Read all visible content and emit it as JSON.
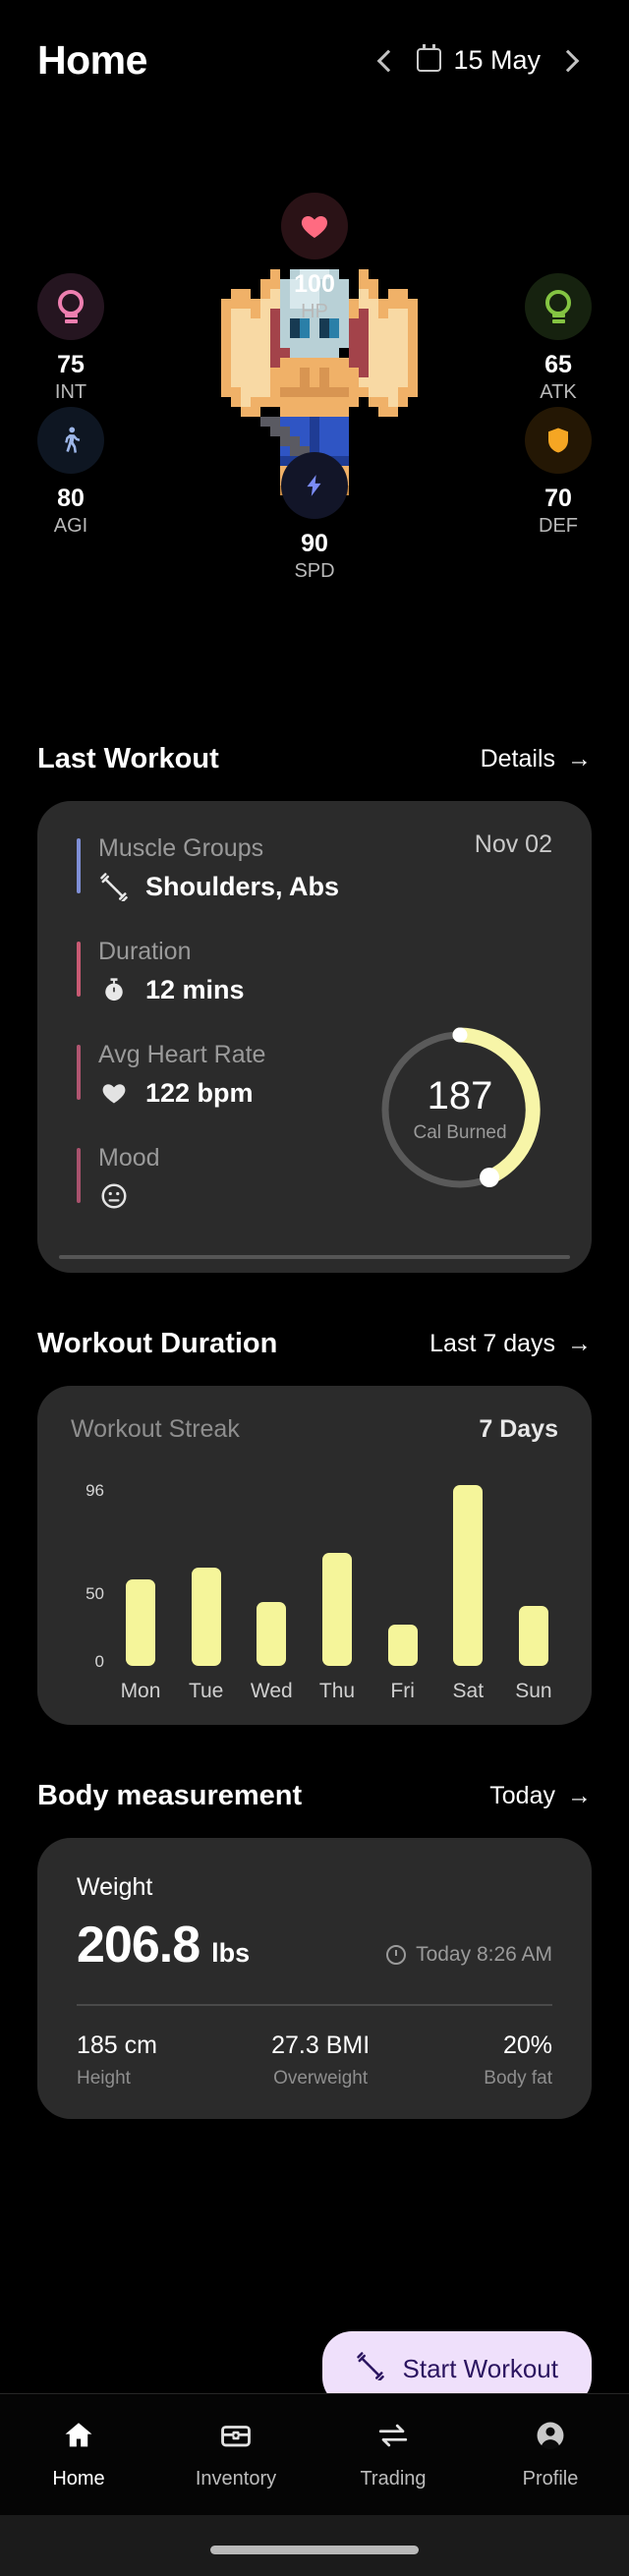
{
  "header": {
    "title": "Home",
    "prev_icon": "chevron-left-icon",
    "next_icon": "chevron-right-icon",
    "calendar_icon": "calendar-icon",
    "date": "15 May"
  },
  "avatar": {
    "sprite_name": "pixel-dragon-character",
    "stats": [
      {
        "key": "HP",
        "value": "100",
        "icon": "heart-icon",
        "icon_color": "#ff6b81",
        "bubble_color": "#2a1216"
      },
      {
        "key": "INT",
        "value": "75",
        "icon": "bulb-icon",
        "icon_color": "#ee7fb0",
        "bubble_color": "#251520"
      },
      {
        "key": "ATK",
        "value": "65",
        "icon": "bulb-icon",
        "icon_color": "#84c442",
        "bubble_color": "#16220f"
      },
      {
        "key": "AGI",
        "value": "80",
        "icon": "walk-icon",
        "icon_color": "#9db6e8",
        "bubble_color": "#0e1622"
      },
      {
        "key": "DEF",
        "value": "70",
        "icon": "shield-icon",
        "icon_color": "#f5a623",
        "bubble_color": "#241704"
      },
      {
        "key": "SPD",
        "value": "90",
        "icon": "bolt-icon",
        "icon_color": "#7b8cf5",
        "bubble_color": "#121528"
      }
    ]
  },
  "last_workout": {
    "section_title": "Last Workout",
    "section_link": "Details",
    "date": "Nov 02",
    "metrics": [
      {
        "label": "Muscle Groups",
        "value": "Shoulders, Abs",
        "icon": "dumbbell-icon",
        "accent": "#7f8fd6"
      },
      {
        "label": "Duration",
        "value": "12 mins",
        "icon": "stopwatch-icon",
        "accent": "#c85a73"
      },
      {
        "label": "Avg Heart Rate",
        "value": "122 bpm",
        "icon": "heart-icon",
        "accent": "#b05570"
      },
      {
        "label": "Mood",
        "value": "",
        "icon": "neutral-face-icon",
        "accent": "#a8526d"
      }
    ],
    "calories": {
      "value": "187",
      "label": "Cal Burned",
      "percent": 45,
      "ring_color": "#f7f5a8",
      "track_color": "#5a5a5a"
    }
  },
  "workout_duration": {
    "section_title": "Workout Duration",
    "section_link": "Last 7 days",
    "streak_label": "Workout Streak",
    "streak_value": "7 Days"
  },
  "chart_data": {
    "type": "bar",
    "title": "Workout Duration",
    "categories": [
      "Mon",
      "Tue",
      "Wed",
      "Thu",
      "Fri",
      "Sat",
      "Sun"
    ],
    "values": [
      46,
      52,
      34,
      60,
      22,
      96,
      32
    ],
    "xlabel": "",
    "ylabel": "",
    "ylim": [
      0,
      96
    ],
    "yticks": [
      "0",
      "50",
      "96"
    ],
    "grid": false,
    "legend": "none",
    "bar_color": "#f5f59a"
  },
  "body_measurement": {
    "section_title": "Body measurement",
    "section_link": "Today",
    "weight_label": "Weight",
    "weight_value": "206.8",
    "weight_unit": "lbs",
    "timestamp": "Today 8:26 AM",
    "clock_icon": "clock-icon",
    "stats": [
      {
        "value": "185 cm",
        "label": "Height"
      },
      {
        "value": "27.3 BMI",
        "label": "Overweight"
      },
      {
        "value": "20%",
        "label": "Body fat"
      }
    ]
  },
  "fab": {
    "label": "Start Workout",
    "icon": "dumbbell-icon",
    "bg_color": "#efe0fb",
    "text_color": "#2b1560"
  },
  "bottom_nav": {
    "items": [
      {
        "label": "Home",
        "icon": "home-icon",
        "active": true
      },
      {
        "label": "Inventory",
        "icon": "chest-icon",
        "active": false
      },
      {
        "label": "Trading",
        "icon": "exchange-icon",
        "active": false
      },
      {
        "label": "Profile",
        "icon": "person-icon",
        "active": false
      }
    ]
  }
}
